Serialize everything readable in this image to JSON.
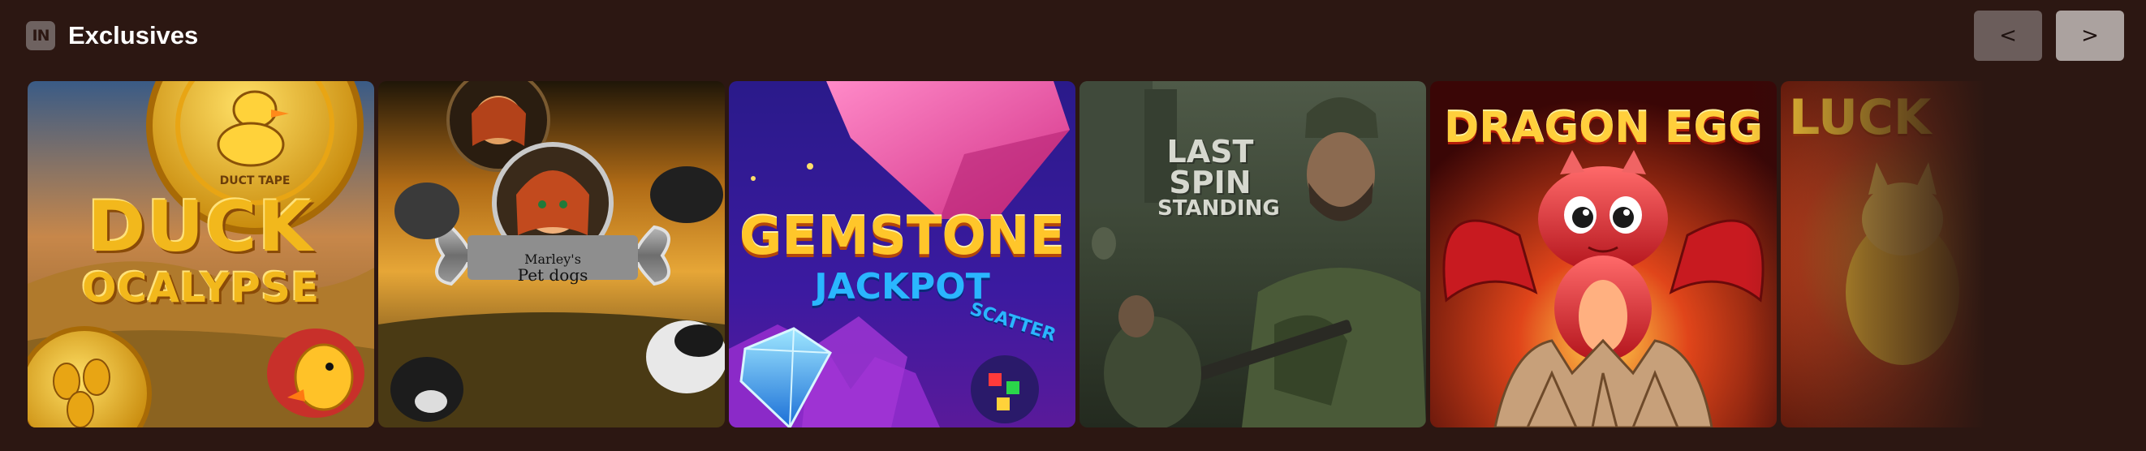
{
  "header": {
    "logo_text": "IN",
    "title": "Exclusives"
  },
  "nav": {
    "prev_label": "<",
    "next_label": ">"
  },
  "games": [
    {
      "image_text_1": "DUCK",
      "image_text_2": "OCALYPSE",
      "badge_text": "DUCT TAPE",
      "icon": "duck-icon"
    },
    {
      "image_text_1": "Marley's",
      "image_text_2": "Pet dogs",
      "icon": "bone-icon"
    },
    {
      "image_text_1": "GEMSTONE",
      "image_text_2": "JACKPOT",
      "badge_text": "SCATTER",
      "icon": "gem-icon"
    },
    {
      "image_text_1": "LAST",
      "image_text_2": "SPIN",
      "image_text_3": "STANDING",
      "icon": "soldier-icon"
    },
    {
      "image_text_1": "DRAGON",
      "image_text_2": "EGG",
      "icon": "dragon-icon"
    },
    {
      "image_text_1": "LUCK",
      "icon": "cat-icon"
    }
  ],
  "colors": {
    "background": "#2c1712",
    "title": "#ffffff",
    "nav_prev_bg": "#6b5d5b",
    "nav_next_bg": "#aba29f"
  }
}
